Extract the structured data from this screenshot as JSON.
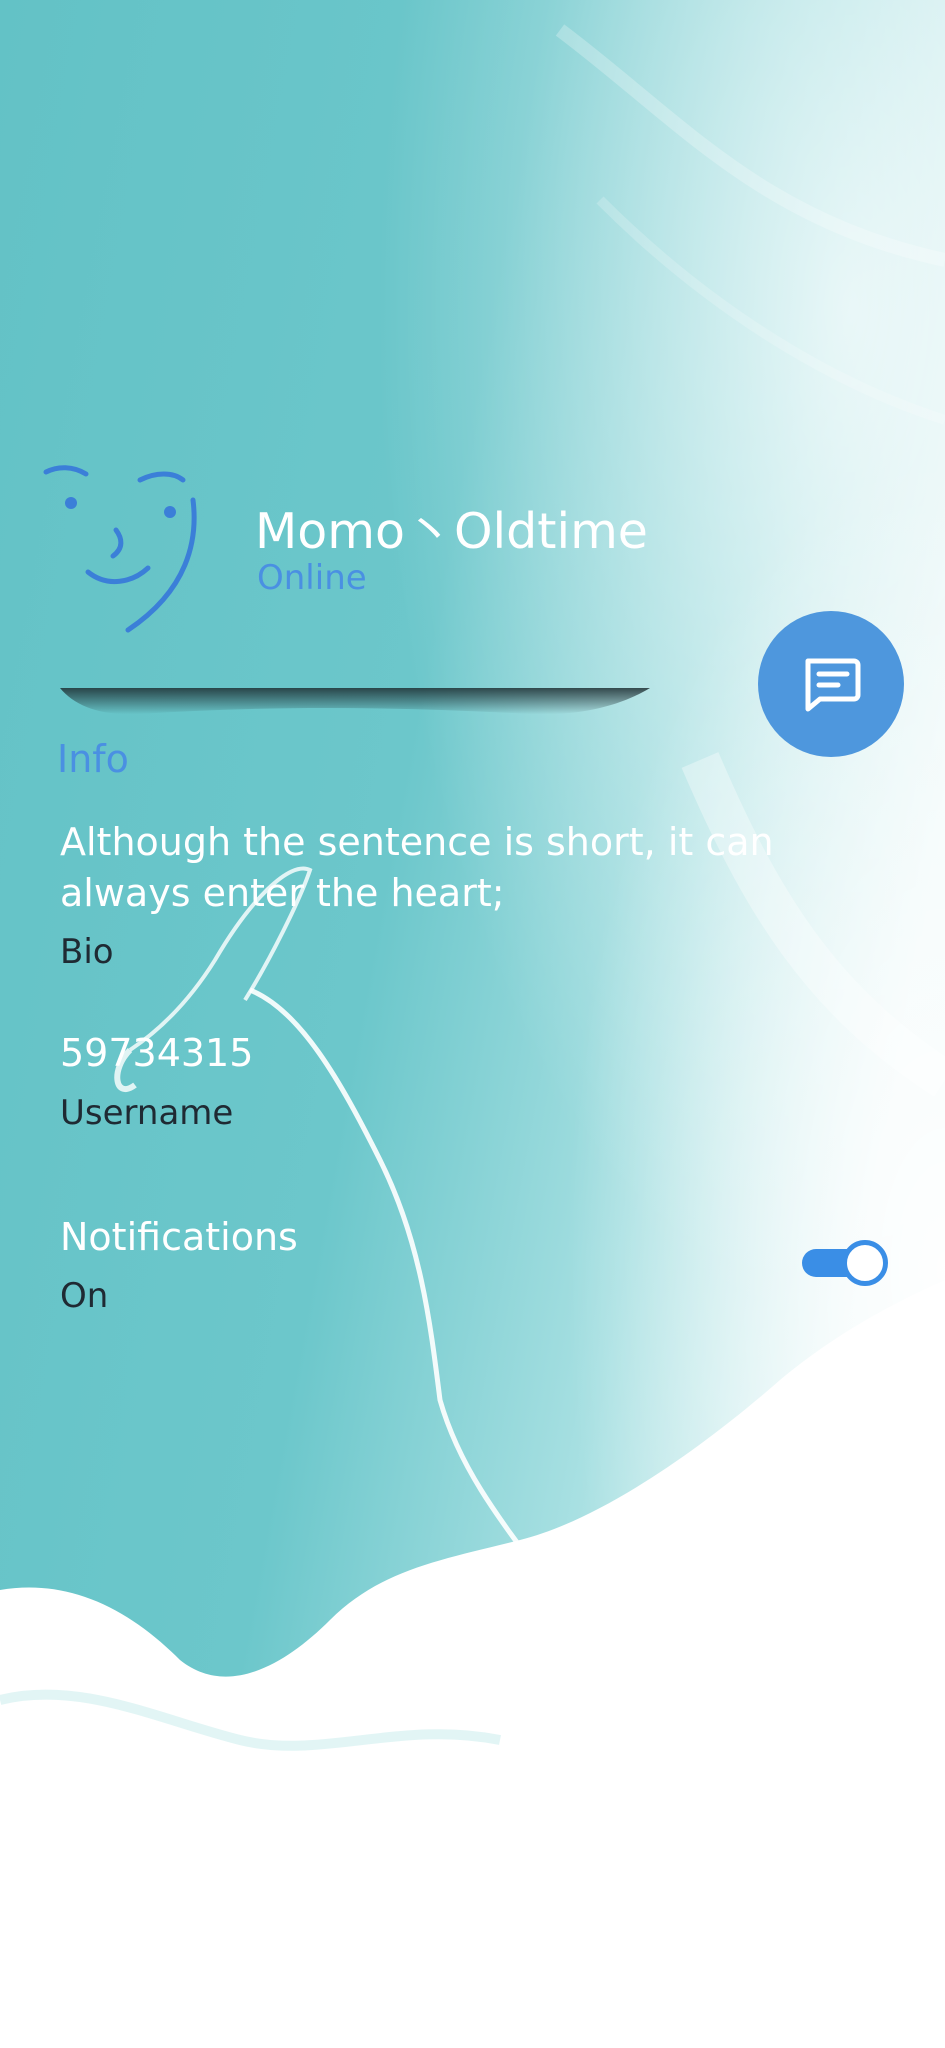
{
  "profile": {
    "name": "Momo丶Oldtime",
    "status": "Online",
    "avatar_icon": "doodle-face-icon"
  },
  "fab": {
    "icon": "message-icon"
  },
  "info": {
    "section_title": "Info",
    "bio": {
      "value": "Although the sentence is short, it can always enter the heart;",
      "label": "Bio"
    },
    "username": {
      "value": "59734315",
      "label": "Username"
    },
    "notifications": {
      "value": "Notifications",
      "label": "On",
      "enabled": true
    }
  },
  "colors": {
    "teal_background": "#64c3c7",
    "accent_blue": "#4a90e2",
    "fab_blue": "#4e97dd"
  }
}
